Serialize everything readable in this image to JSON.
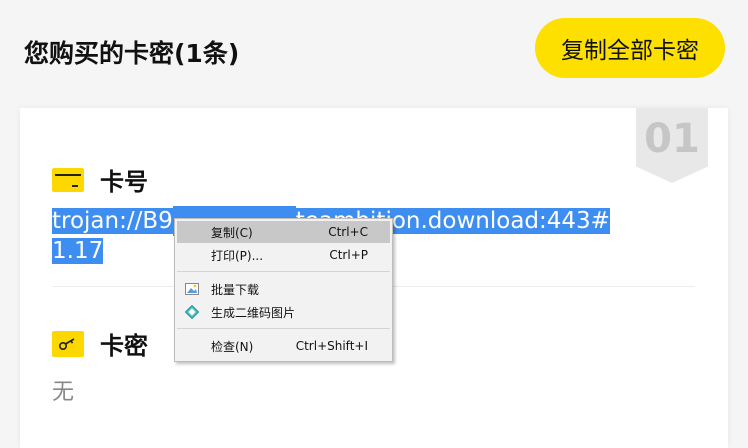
{
  "header": {
    "title": "您购买的卡密(1条)",
    "copy_all_label": "复制全部卡密"
  },
  "card": {
    "index": "01",
    "number_label": "卡号",
    "number_value": "trojan://B9",
    "number_value_end": "teambition.download:443#",
    "number_value_line2": "1.17",
    "secret_label": "卡密",
    "secret_value": "无"
  },
  "context_menu": {
    "items": [
      {
        "label": "复制(C)",
        "shortcut": "Ctrl+C"
      },
      {
        "label": "打印(P)...",
        "shortcut": "Ctrl+P"
      },
      {
        "label": "批量下载",
        "icon": "image-download-icon"
      },
      {
        "label": "生成二维码图片",
        "icon": "qr-diamond-icon"
      },
      {
        "label": "检查(N)",
        "shortcut": "Ctrl+Shift+I"
      }
    ]
  },
  "colors": {
    "accent": "#fde000",
    "selection": "#3d8ef0"
  }
}
